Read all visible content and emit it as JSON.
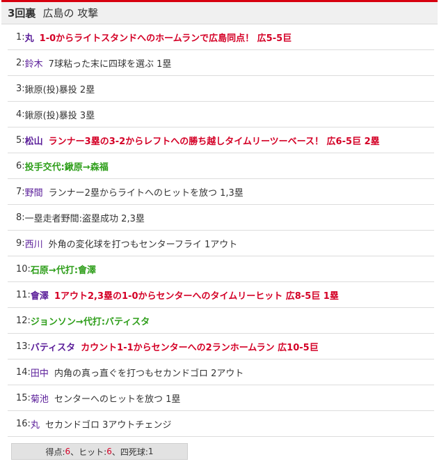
{
  "header": {
    "inning": "3回裏",
    "title": "広島の 攻撃"
  },
  "plays": [
    {
      "no": "1:",
      "name": "丸",
      "text": "1-0からライトスタンドへのホームランで広島同点！ 広5-5巨",
      "kind": "score"
    },
    {
      "no": "2:",
      "name": "鈴木",
      "text": "7球粘った末に四球を選ぶ 1塁",
      "kind": "normal"
    },
    {
      "no": "3:",
      "name": "",
      "text": "鍬原(投)暴投 2塁",
      "kind": "normal"
    },
    {
      "no": "4:",
      "name": "",
      "text": "鍬原(投)暴投 3塁",
      "kind": "normal"
    },
    {
      "no": "5:",
      "name": "松山",
      "text": "ランナー3塁の3-2からレフトへの勝ち越しタイムリーツーベース！ 広6-5巨 2塁",
      "kind": "score"
    },
    {
      "no": "6:",
      "name": "",
      "text": "投手交代:鍬原→森福",
      "kind": "change"
    },
    {
      "no": "7:",
      "name": "野間",
      "text": "ランナー2塁からライトへのヒットを放つ 1,3塁",
      "kind": "normal"
    },
    {
      "no": "8:",
      "name": "",
      "text": "一塁走者野間:盗塁成功 2,3塁",
      "kind": "normal"
    },
    {
      "no": "9:",
      "name": "西川",
      "text": "外角の変化球を打つもセンターフライ 1アウト",
      "kind": "normal"
    },
    {
      "no": "10:",
      "name": "",
      "text": "石原→代打:會澤",
      "kind": "change"
    },
    {
      "no": "11:",
      "name": "會澤",
      "text": "1アウト2,3塁の1-0からセンターへのタイムリーヒット 広8-5巨 1塁",
      "kind": "score"
    },
    {
      "no": "12:",
      "name": "",
      "text": "ジョンソン→代打:バティスタ",
      "kind": "change"
    },
    {
      "no": "13:",
      "name": "バティスタ",
      "text": "カウント1-1からセンターへの2ランホームラン 広10-5巨",
      "kind": "score"
    },
    {
      "no": "14:",
      "name": "田中",
      "text": "内角の真っ直ぐを打つもセカンドゴロ 2アウト",
      "kind": "normal"
    },
    {
      "no": "15:",
      "name": "菊池",
      "text": "センターへのヒットを放つ 1塁",
      "kind": "normal"
    },
    {
      "no": "16:",
      "name": "丸",
      "text": "セカンドゴロ 3アウトチェンジ",
      "kind": "normal"
    }
  ],
  "summary": {
    "runs_label": "得点:",
    "runs": "6",
    "hits_label": "ヒット:",
    "hits": "6",
    "walks_label": "四死球:",
    "walks": "1",
    "sep": "、"
  },
  "colors": {
    "accent": "#d7000f",
    "score": "#d40026",
    "change": "#2e9e1a",
    "player": "#5a1d99"
  }
}
